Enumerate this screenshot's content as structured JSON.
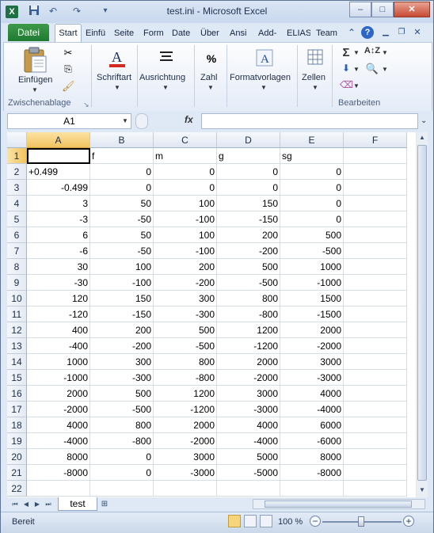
{
  "window": {
    "title": "test.ini - Microsoft Excel",
    "minimize": "–",
    "maximize": "□",
    "close": "✕"
  },
  "quick_access": {
    "app": "X",
    "save": "💾",
    "undo": "↶",
    "redo": "↷",
    "customize": "▾"
  },
  "ribbon_tabs": {
    "file": "Datei",
    "tabs": [
      "Start",
      "Einfü",
      "Seite",
      "Form",
      "Date",
      "Über",
      "Ansi",
      "Add-",
      "ELIAS",
      "Team"
    ],
    "active": "Start"
  },
  "ribbon": {
    "paste_label": "Einfügen",
    "clipboard_group": "Zwischenablage",
    "font_label": "Schriftart",
    "alignment_label": "Ausrichtung",
    "number_label": "Zahl",
    "styles_label": "Formatvorlagen",
    "cells_label": "Zellen",
    "editing_group": "Bearbeiten",
    "sum_symbol": "Σ",
    "percent_symbol": "%"
  },
  "formula_bar": {
    "name_box": "A1",
    "fx": "fx",
    "formula": ""
  },
  "grid": {
    "columns": [
      "A",
      "B",
      "C",
      "D",
      "E",
      "F"
    ],
    "rows": [
      [
        "",
        "f",
        "m",
        "g",
        "sg",
        ""
      ],
      [
        "+0.499",
        "0",
        "0",
        "0",
        "0",
        ""
      ],
      [
        "-0.499",
        "0",
        "0",
        "0",
        "0",
        ""
      ],
      [
        "3",
        "50",
        "100",
        "150",
        "0",
        ""
      ],
      [
        "-3",
        "-50",
        "-100",
        "-150",
        "0",
        ""
      ],
      [
        "6",
        "50",
        "100",
        "200",
        "500",
        ""
      ],
      [
        "-6",
        "-50",
        "-100",
        "-200",
        "-500",
        ""
      ],
      [
        "30",
        "100",
        "200",
        "500",
        "1000",
        ""
      ],
      [
        "-30",
        "-100",
        "-200",
        "-500",
        "-1000",
        ""
      ],
      [
        "120",
        "150",
        "300",
        "800",
        "1500",
        ""
      ],
      [
        "-120",
        "-150",
        "-300",
        "-800",
        "-1500",
        ""
      ],
      [
        "400",
        "200",
        "500",
        "1200",
        "2000",
        ""
      ],
      [
        "-400",
        "-200",
        "-500",
        "-1200",
        "-2000",
        ""
      ],
      [
        "1000",
        "300",
        "800",
        "2000",
        "3000",
        ""
      ],
      [
        "-1000",
        "-300",
        "-800",
        "-2000",
        "-3000",
        ""
      ],
      [
        "2000",
        "500",
        "1200",
        "3000",
        "4000",
        ""
      ],
      [
        "-2000",
        "-500",
        "-1200",
        "-3000",
        "-4000",
        ""
      ],
      [
        "4000",
        "800",
        "2000",
        "4000",
        "6000",
        ""
      ],
      [
        "-4000",
        "-800",
        "-2000",
        "-4000",
        "-6000",
        ""
      ],
      [
        "8000",
        "0",
        "3000",
        "5000",
        "8000",
        ""
      ],
      [
        "-8000",
        "0",
        "-3000",
        "-5000",
        "-8000",
        ""
      ],
      [
        "",
        "",
        "",
        "",
        "",
        ""
      ]
    ],
    "row_numbers": [
      "1",
      "2",
      "3",
      "4",
      "5",
      "6",
      "7",
      "8",
      "9",
      "10",
      "11",
      "12",
      "13",
      "14",
      "15",
      "16",
      "17",
      "18",
      "19",
      "20",
      "21",
      "22"
    ]
  },
  "sheets": {
    "tabs": [
      "test"
    ],
    "active": "test"
  },
  "status_bar": {
    "ready": "Bereit",
    "zoom": "100 %",
    "zoom_out": "−",
    "zoom_in": "+"
  }
}
